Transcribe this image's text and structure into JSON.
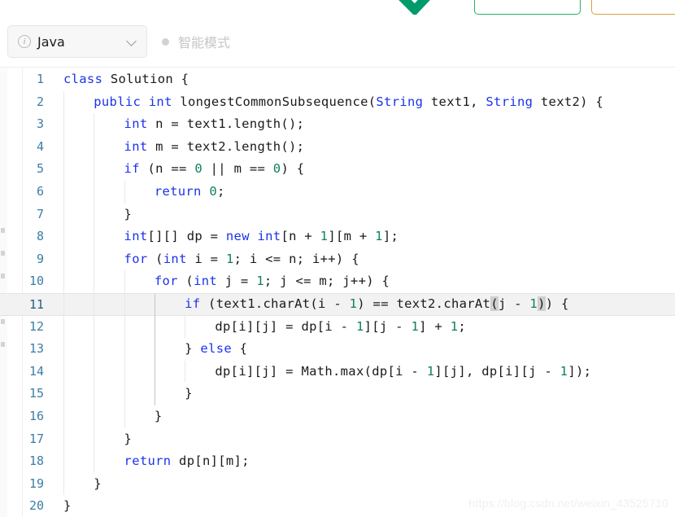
{
  "topbar": {
    "check_icon": "check-icon",
    "submit_button_label": "",
    "run_button_label": "",
    "green_color": "#27b16a",
    "orange_color": "#d7a23f",
    "check_color": "#009a6b"
  },
  "toolbar": {
    "language_select": {
      "icon": "info-icon",
      "value": "Java",
      "chevron": "chevron-down-icon"
    },
    "smart_mode": {
      "dot": "status-dot",
      "label": "智能模式"
    }
  },
  "editor": {
    "active_line": 11,
    "line_number_color": "#3d7ea6",
    "keyword_color": "#1a33ee",
    "number_color": "#108060",
    "lines": [
      {
        "n": "1",
        "indent": 0,
        "text": "class Solution {"
      },
      {
        "n": "2",
        "indent": 1,
        "text": "public int longestCommonSubsequence(String text1, String text2) {"
      },
      {
        "n": "3",
        "indent": 2,
        "text": "int n = text1.length();"
      },
      {
        "n": "4",
        "indent": 2,
        "text": "int m = text2.length();"
      },
      {
        "n": "5",
        "indent": 2,
        "text": "if (n == 0 || m == 0) {"
      },
      {
        "n": "6",
        "indent": 3,
        "text": "return 0;"
      },
      {
        "n": "7",
        "indent": 2,
        "text": "}"
      },
      {
        "n": "8",
        "indent": 2,
        "text": "int[][] dp = new int[n + 1][m + 1];"
      },
      {
        "n": "9",
        "indent": 2,
        "text": "for (int i = 1; i <= n; i++) {"
      },
      {
        "n": "10",
        "indent": 3,
        "text": "for (int j = 1; j <= m; j++) {"
      },
      {
        "n": "11",
        "indent": 4,
        "text": "if (text1.charAt(i - 1) == text2.charAt(j - 1)) {"
      },
      {
        "n": "12",
        "indent": 5,
        "text": "dp[i][j] = dp[i - 1][j - 1] + 1;"
      },
      {
        "n": "13",
        "indent": 4,
        "text": "} else {"
      },
      {
        "n": "14",
        "indent": 5,
        "text": "dp[i][j] = Math.max(dp[i - 1][j], dp[i][j - 1]);"
      },
      {
        "n": "15",
        "indent": 4,
        "text": "}"
      },
      {
        "n": "16",
        "indent": 3,
        "text": "}"
      },
      {
        "n": "17",
        "indent": 2,
        "text": "}"
      },
      {
        "n": "18",
        "indent": 2,
        "text": "return dp[n][m];"
      },
      {
        "n": "19",
        "indent": 1,
        "text": "}"
      },
      {
        "n": "20",
        "indent": 0,
        "text": "}"
      }
    ]
  },
  "watermark": {
    "text": "https://blog.csdn.net/weixin_43525710"
  }
}
